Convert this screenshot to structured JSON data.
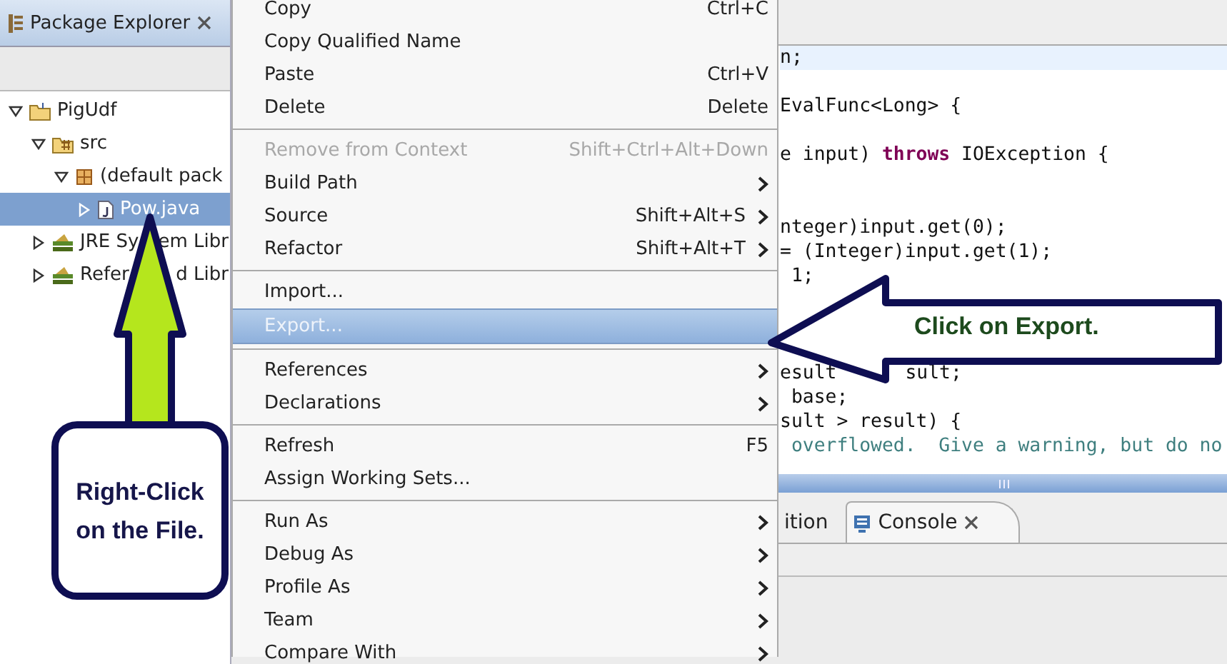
{
  "explorer": {
    "title": "Package Explorer",
    "tree": [
      {
        "label": [
          "PigUdf"
        ],
        "kind": "project",
        "expanded": true,
        "selected": false,
        "children": [
          {
            "label": [
              "src"
            ],
            "kind": "sourcefolder",
            "expanded": true,
            "selected": false,
            "children": [
              {
                "label": [
                  "(default pack"
                ],
                "kind": "package",
                "expanded": true,
                "selected": false,
                "children": [
                  {
                    "label": [
                      "Pow.java"
                    ],
                    "kind": "file",
                    "expanded": false,
                    "selected": true
                  }
                ]
              }
            ]
          },
          {
            "label": [
              "JRE Sy",
              "em Libr"
            ],
            "kind": "library",
            "expanded": false,
            "selected": false
          },
          {
            "label": [
              "Refer",
              "d Libr"
            ],
            "kind": "library",
            "expanded": false,
            "selected": false
          }
        ]
      }
    ]
  },
  "editor": {
    "lines": [
      {
        "current": true,
        "kind": "first",
        "parts": [
          {
            "text": "n;",
            "kind": "plain"
          }
        ]
      },
      {
        "current": false,
        "kind": "spaced",
        "parts": [
          {
            "text": "EvalFunc<Long> {",
            "kind": "plain"
          }
        ]
      },
      {
        "current": false,
        "kind": "spaced",
        "parts": [
          {
            "text": "e input) ",
            "kind": "plain"
          },
          {
            "text": "throws",
            "kind": "keyword"
          },
          {
            "text": " IOException {",
            "kind": "plain"
          }
        ]
      },
      {
        "current": false,
        "kind": "doublespaced",
        "parts": [
          {
            "text": "nteger)input.get(0);",
            "kind": "plain"
          }
        ]
      },
      {
        "current": false,
        "kind": "next",
        "parts": [
          {
            "text": "= (Integer)input.get(1);",
            "kind": "plain"
          }
        ]
      },
      {
        "current": false,
        "kind": "next",
        "parts": [
          {
            "text": " 1;",
            "kind": "plain"
          }
        ]
      },
      {
        "current": false,
        "kind": "triplespaced",
        "parts": [
          {
            "text": "esult",
            "kind": "plain"
          },
          {
            "text": "sult;",
            "kind": "afterarrow"
          }
        ]
      },
      {
        "current": false,
        "kind": "next",
        "parts": [
          {
            "text": " base;",
            "kind": "plain"
          }
        ]
      },
      {
        "current": false,
        "kind": "next",
        "parts": [
          {
            "text": "sult > result) {",
            "kind": "plain"
          }
        ]
      },
      {
        "current": false,
        "kind": "next",
        "parts": [
          {
            "text": " overflowed.  Give a warning, but do no",
            "kind": "comment"
          }
        ]
      }
    ]
  },
  "bottom_panel": {
    "tabs": [
      {
        "label": "ition",
        "selected": false
      },
      {
        "label": "Console",
        "selected": true
      }
    ]
  },
  "context_menu": {
    "items": [
      {
        "kind": "item",
        "label": "Copy",
        "shortcut": "Ctrl+C",
        "submenu": false,
        "disabled": false,
        "selected": false
      },
      {
        "kind": "item",
        "label": "Copy Qualified Name",
        "submenu": false,
        "disabled": false,
        "selected": false
      },
      {
        "kind": "item",
        "label": "Paste",
        "shortcut": "Ctrl+V",
        "submenu": false,
        "disabled": false,
        "selected": false
      },
      {
        "kind": "item",
        "label": "Delete",
        "shortcut": "Delete",
        "submenu": false,
        "disabled": false,
        "selected": false
      },
      {
        "kind": "separator"
      },
      {
        "kind": "item",
        "label": "Remove from Context",
        "shortcut": "Shift+Ctrl+Alt+Down",
        "submenu": false,
        "disabled": true,
        "selected": false
      },
      {
        "kind": "item",
        "label": "Build Path",
        "submenu": true,
        "disabled": false,
        "selected": false
      },
      {
        "kind": "item",
        "label": "Source",
        "shortcut": "Shift+Alt+S",
        "submenu": true,
        "disabled": false,
        "selected": false
      },
      {
        "kind": "item",
        "label": "Refactor",
        "shortcut": "Shift+Alt+T",
        "submenu": true,
        "disabled": false,
        "selected": false
      },
      {
        "kind": "separator"
      },
      {
        "kind": "item",
        "label": "Import...",
        "submenu": false,
        "disabled": false,
        "selected": false
      },
      {
        "kind": "item",
        "label": "Export...",
        "submenu": false,
        "disabled": false,
        "selected": true
      },
      {
        "kind": "separator"
      },
      {
        "kind": "item",
        "label": "References",
        "submenu": true,
        "disabled": false,
        "selected": false
      },
      {
        "kind": "item",
        "label": "Declarations",
        "submenu": true,
        "disabled": false,
        "selected": false
      },
      {
        "kind": "separator"
      },
      {
        "kind": "item",
        "label": "Refresh",
        "shortcut": "F5",
        "submenu": false,
        "disabled": false,
        "selected": false
      },
      {
        "kind": "item",
        "label": "Assign Working Sets...",
        "submenu": false,
        "disabled": false,
        "selected": false
      },
      {
        "kind": "separator"
      },
      {
        "kind": "item",
        "label": "Run As",
        "submenu": true,
        "disabled": false,
        "selected": false
      },
      {
        "kind": "item",
        "label": "Debug As",
        "submenu": true,
        "disabled": false,
        "selected": false
      },
      {
        "kind": "item",
        "label": "Profile As",
        "submenu": true,
        "disabled": false,
        "selected": false
      },
      {
        "kind": "item",
        "label": "Team",
        "submenu": true,
        "disabled": false,
        "selected": false
      },
      {
        "kind": "item",
        "label": "Compare With",
        "submenu": true,
        "disabled": false,
        "selected": false
      }
    ]
  },
  "callouts": [
    {
      "kind": "up-arrow",
      "text": "Right-Click on the File."
    },
    {
      "kind": "left-arrow",
      "text": "Click on Export."
    }
  ]
}
